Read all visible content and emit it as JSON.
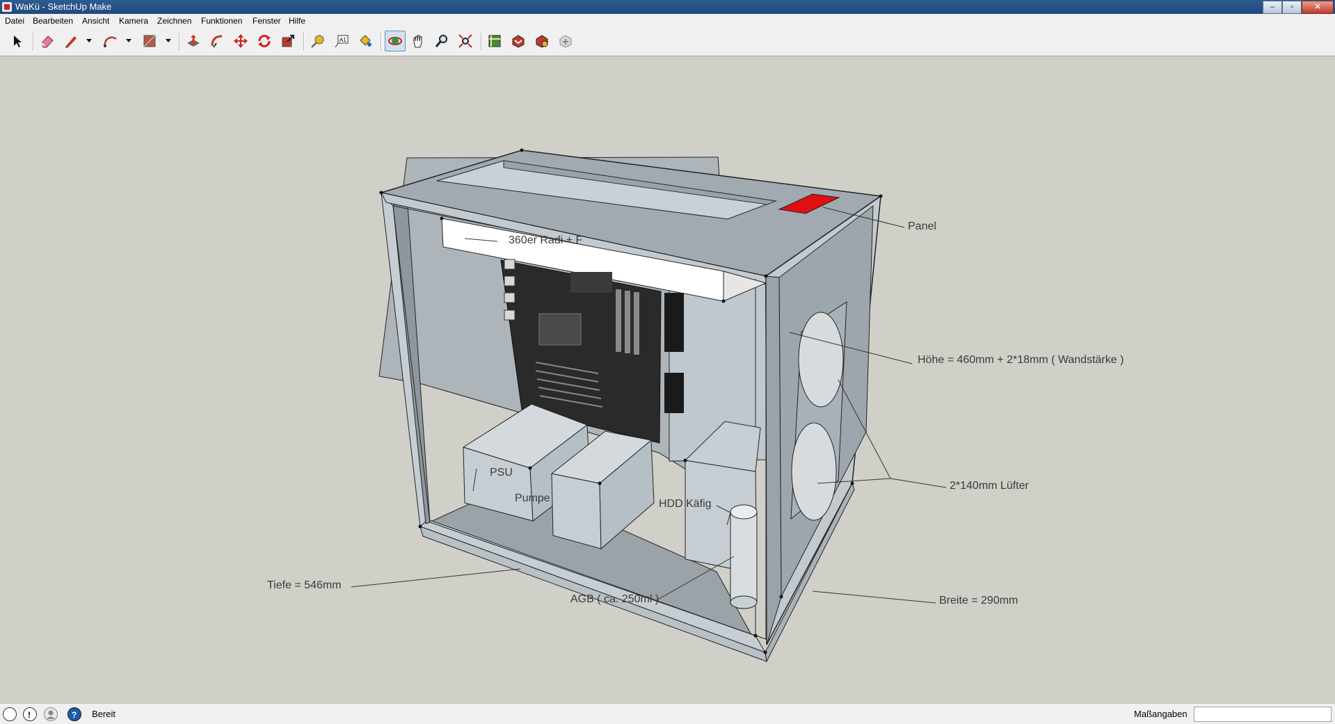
{
  "window": {
    "title": "WaKü - SketchUp Make",
    "buttons": {
      "minimize": "–",
      "maximize": "▫",
      "close": "✕"
    }
  },
  "menu": [
    "Datei",
    "Bearbeiten",
    "Ansicht",
    "Kamera",
    "Zeichnen",
    "Funktionen",
    "Fenster",
    "Hilfe"
  ],
  "toolbar": {
    "tools": [
      "select-icon",
      "eraser-icon",
      "pencil-icon",
      "arc-icon",
      "rectangle-icon",
      "push-pull-icon",
      "follow-me-icon",
      "move-icon",
      "rotate-icon",
      "scale-icon",
      "tape-measure-icon",
      "text-label-icon",
      "paint-bucket-icon",
      "orbit-icon",
      "pan-icon",
      "zoom-icon",
      "zoom-extents-icon",
      "3d-warehouse-icon",
      "get-models-icon",
      "share-model-icon",
      "extension-warehouse-icon"
    ],
    "active": "orbit-icon"
  },
  "labels": {
    "radi": "360er Radi + F",
    "panel": "Panel",
    "hoehe": "Höhe = 460mm + 2*18mm ( Wandstärke )",
    "luefter": "2*140mm Lüfter",
    "psu": "PSU",
    "pumpe": "Pumpe",
    "hdd": "HDD Käfig",
    "tiefe": "Tiefe = 546mm",
    "agb": "AGB ( ca. 250ml )",
    "breite": "Breite = 290mm"
  },
  "colors": {
    "case_gray": "#9aa4ac",
    "case_light": "#c4ccd3",
    "panel_red": "#e01010",
    "background": "#d0d0c9"
  },
  "status": {
    "text": "Bereit",
    "measurements_label": "Maßangaben",
    "measurements_value": ""
  }
}
